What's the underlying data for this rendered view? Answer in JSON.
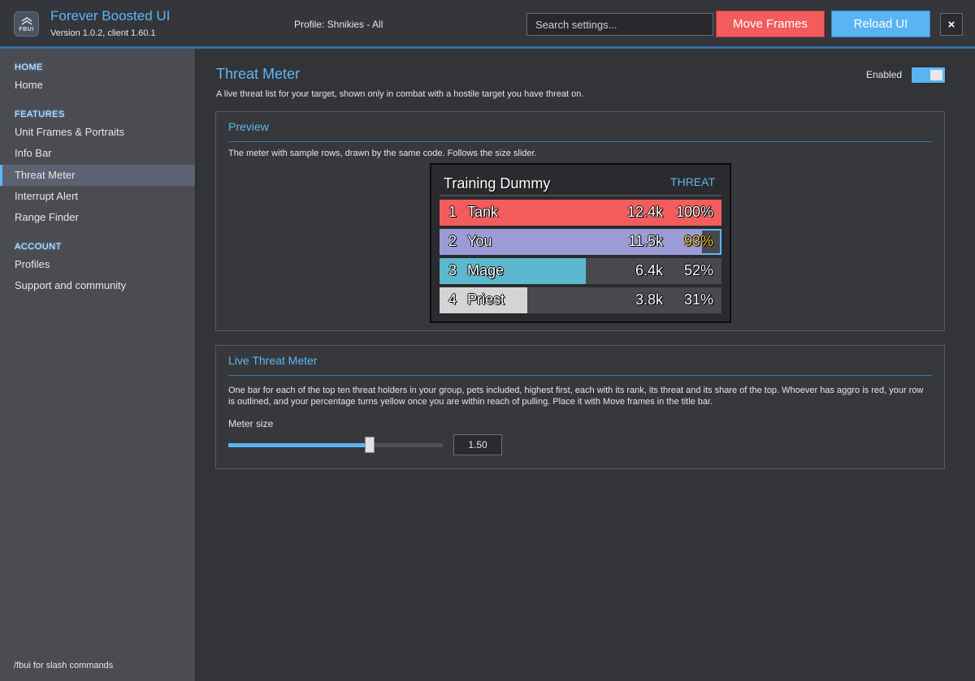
{
  "app": {
    "title": "Forever Boosted UI",
    "version": "Version 1.0.2, client 1.60.1",
    "logo_text": "FBUI"
  },
  "header": {
    "profile": "Profile: Shnikies - All",
    "search_placeholder": "Search settings...",
    "move_frames_label": "Move Frames",
    "reload_label": "Reload UI",
    "close_label": "×"
  },
  "sidebar": {
    "sections": [
      {
        "label": "HOME",
        "items": [
          "Home"
        ]
      },
      {
        "label": "FEATURES",
        "items": [
          "Unit Frames & Portraits",
          "Info Bar",
          "Threat Meter",
          "Interrupt Alert",
          "Range Finder"
        ]
      },
      {
        "label": "ACCOUNT",
        "items": [
          "Profiles",
          "Support and community"
        ]
      }
    ],
    "active_item": "Threat Meter",
    "footer": "/fbui for slash commands"
  },
  "page": {
    "title": "Threat Meter",
    "description": "A live threat list for your target, shown only in combat with a hostile target you have threat on.",
    "enabled_label": "Enabled",
    "enabled": true
  },
  "preview": {
    "title": "Preview",
    "description": "The meter with sample rows, drawn by the same code.  Follows the size slider.",
    "meter_title": "Training Dummy",
    "meter_header": "THREAT",
    "rows": [
      {
        "rank": "1",
        "name": "Tank",
        "value": "12.4k",
        "pct": "100%",
        "fill": 1.0,
        "color": "#f25c5c",
        "pct_color": "#ffffff",
        "outlined": false
      },
      {
        "rank": "2",
        "name": "You",
        "value": "11.5k",
        "pct": "93%",
        "fill": 0.93,
        "color": "#9b9bd6",
        "pct_color": "#f5d04a",
        "outlined": true
      },
      {
        "rank": "3",
        "name": "Mage",
        "value": "6.4k",
        "pct": "52%",
        "fill": 0.52,
        "color": "#5cb8cc",
        "pct_color": "#ffffff",
        "outlined": false
      },
      {
        "rank": "4",
        "name": "Priest",
        "value": "3.8k",
        "pct": "31%",
        "fill": 0.31,
        "color": "#d4d4d4",
        "pct_color": "#ffffff",
        "outlined": false
      }
    ]
  },
  "live": {
    "title": "Live Threat Meter",
    "description": "One bar for each of the top ten threat holders in your group, pets included, highest first, each with its rank, its threat and its share of the top.  Whoever has aggro is red, your row is outlined, and your percentage turns yellow once you are within reach of pulling.  Place it with Move frames in the title bar.",
    "slider_label": "Meter size",
    "slider_value": "1.50",
    "slider_fraction": 0.66
  },
  "colors": {
    "accent": "#5db6f5",
    "danger": "#f25c5c"
  }
}
